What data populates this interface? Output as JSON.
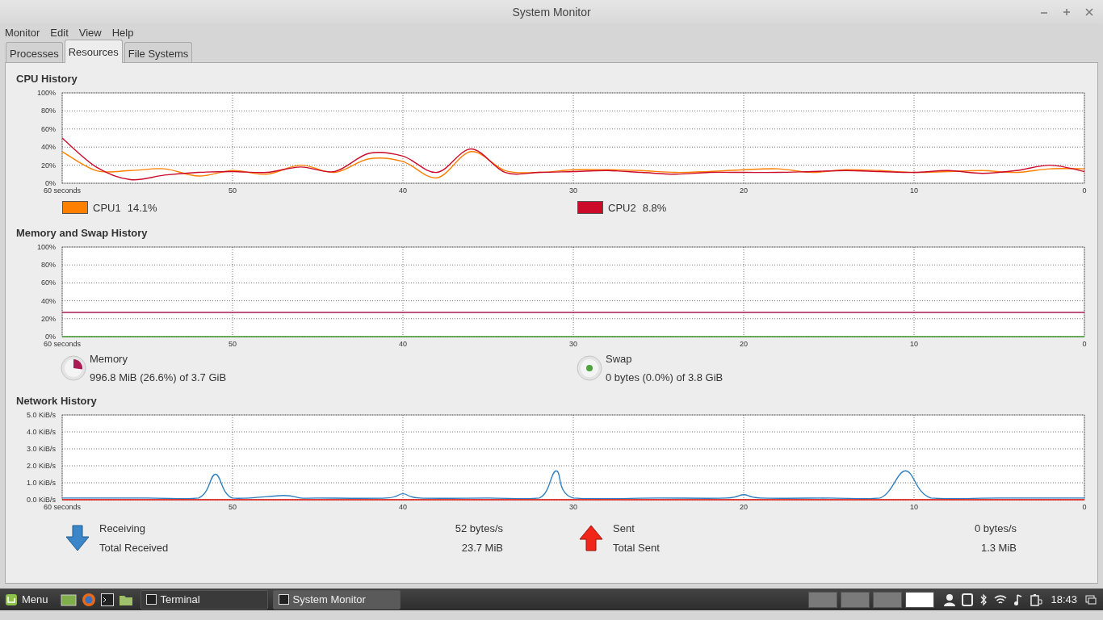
{
  "window": {
    "title": "System Monitor"
  },
  "menu": [
    "Monitor",
    "Edit",
    "View",
    "Help"
  ],
  "tabs": [
    {
      "label": "Processes",
      "selected": false
    },
    {
      "label": "Resources",
      "selected": true
    },
    {
      "label": "File Systems",
      "selected": false
    }
  ],
  "cpu": {
    "title": "CPU History",
    "chart_data": {
      "type": "line",
      "grid": true,
      "xlim": [
        60,
        0
      ],
      "ylim": [
        0,
        100
      ],
      "x": [
        60,
        58,
        56,
        54,
        52,
        50,
        48,
        46,
        44,
        42,
        40,
        38,
        36,
        34,
        32,
        30,
        28,
        26,
        24,
        22,
        20,
        18,
        16,
        14,
        12,
        10,
        8,
        6,
        4,
        2,
        0
      ],
      "xticks": [
        {
          "value": 60,
          "label": "60 seconds"
        },
        50,
        40,
        30,
        20,
        10,
        0
      ],
      "yticks": [
        {
          "value": 0,
          "label": "0%"
        },
        {
          "value": 20,
          "label": "20%"
        },
        {
          "value": 40,
          "label": "40%"
        },
        {
          "value": 60,
          "label": "60%"
        },
        {
          "value": 80,
          "label": "80%"
        },
        {
          "value": 100,
          "label": "100%"
        }
      ],
      "series": [
        {
          "name": "CPU1",
          "color": "#ff7f00",
          "values": [
            35,
            14,
            14,
            16,
            8,
            14,
            10,
            20,
            12,
            27,
            24,
            6,
            35,
            14,
            12,
            15,
            15,
            14,
            12,
            13,
            15,
            16,
            12,
            15,
            14,
            12,
            13,
            14,
            12,
            16,
            16
          ]
        },
        {
          "name": "CPU2",
          "color": "#cc0a2a",
          "values": [
            50,
            18,
            4,
            9,
            12,
            13,
            12,
            18,
            13,
            33,
            30,
            12,
            38,
            12,
            12,
            13,
            14,
            12,
            10,
            12,
            12,
            12,
            13,
            14,
            13,
            12,
            14,
            11,
            14,
            20,
            13
          ]
        }
      ]
    },
    "legend": [
      {
        "reading": "14.1%"
      },
      {
        "reading": "8.8%"
      }
    ]
  },
  "memory": {
    "title": "Memory and Swap History",
    "chart_data": {
      "type": "line",
      "grid": true,
      "xlim": [
        60,
        0
      ],
      "ylim": [
        0,
        100
      ],
      "x": [
        60,
        0
      ],
      "xticks": [
        {
          "value": 60,
          "label": "60 seconds"
        },
        50,
        40,
        30,
        20,
        10,
        0
      ],
      "yticks": [
        {
          "value": 0,
          "label": "0%"
        },
        {
          "value": 20,
          "label": "20%"
        },
        {
          "value": 40,
          "label": "40%"
        },
        {
          "value": 60,
          "label": "60%"
        },
        {
          "value": 80,
          "label": "80%"
        },
        {
          "value": 100,
          "label": "100%"
        }
      ],
      "series": [
        {
          "name": "Memory",
          "color": "#ac1a54",
          "values": [
            27,
            27
          ]
        },
        {
          "name": "Swap",
          "color": "#4ea33a",
          "values": [
            0,
            0
          ]
        }
      ]
    },
    "legend": [
      {
        "reading": "996.8 MiB (26.6%) of 3.7 GiB"
      },
      {
        "reading": "0 bytes (0.0%) of 3.8 GiB"
      }
    ]
  },
  "network": {
    "title": "Network History",
    "chart_data": {
      "type": "line",
      "grid": true,
      "xlim": [
        60,
        0
      ],
      "ylim": [
        0,
        5
      ],
      "x": [
        60,
        55,
        52,
        51,
        50,
        47,
        46,
        45,
        41,
        40,
        39,
        35,
        32,
        31,
        30,
        25,
        21,
        20,
        19,
        15,
        12,
        10.5,
        9,
        5,
        0
      ],
      "xticks": [
        {
          "value": 60,
          "label": "60 seconds"
        },
        50,
        40,
        30,
        20,
        10,
        0
      ],
      "yticks": [
        {
          "value": 0,
          "label": "0.0 KiB/s"
        },
        {
          "value": 1,
          "label": "1.0 KiB/s"
        },
        {
          "value": 2,
          "label": "2.0 KiB/s"
        },
        {
          "value": 3,
          "label": "3.0 KiB/s"
        },
        {
          "value": 4,
          "label": "4.0 KiB/s"
        },
        {
          "value": 5,
          "label": "5.0 KiB/s"
        }
      ],
      "series": [
        {
          "name": "Receiving",
          "color": "#2f7fc0",
          "values": [
            0.1,
            0.1,
            0.1,
            1.5,
            0.1,
            0.25,
            0.1,
            0.1,
            0.1,
            0.35,
            0.1,
            0.1,
            0.1,
            1.7,
            0.1,
            0.1,
            0.1,
            0.3,
            0.1,
            0.1,
            0.1,
            1.7,
            0.1,
            0.1,
            0.1
          ]
        },
        {
          "name": "Sent",
          "color": "#e8160c",
          "values": [
            0,
            0,
            0,
            0,
            0,
            0,
            0,
            0,
            0,
            0,
            0,
            0,
            0,
            0,
            0,
            0,
            0,
            0,
            0,
            0,
            0,
            0,
            0,
            0,
            0
          ]
        }
      ]
    },
    "legend": [
      {
        "kind": "down",
        "rate": "52 bytes/s",
        "total_label": "Total Received",
        "total": "23.7 MiB"
      },
      {
        "kind": "up",
        "rate": "0 bytes/s",
        "total_label": "Total Sent",
        "total": "1.3 MiB"
      }
    ]
  },
  "taskbar": {
    "menu_label": "Menu",
    "windows": [
      {
        "label": "Terminal",
        "selected": false
      },
      {
        "label": "System Monitor",
        "selected": true
      }
    ],
    "clock": "18:43"
  }
}
